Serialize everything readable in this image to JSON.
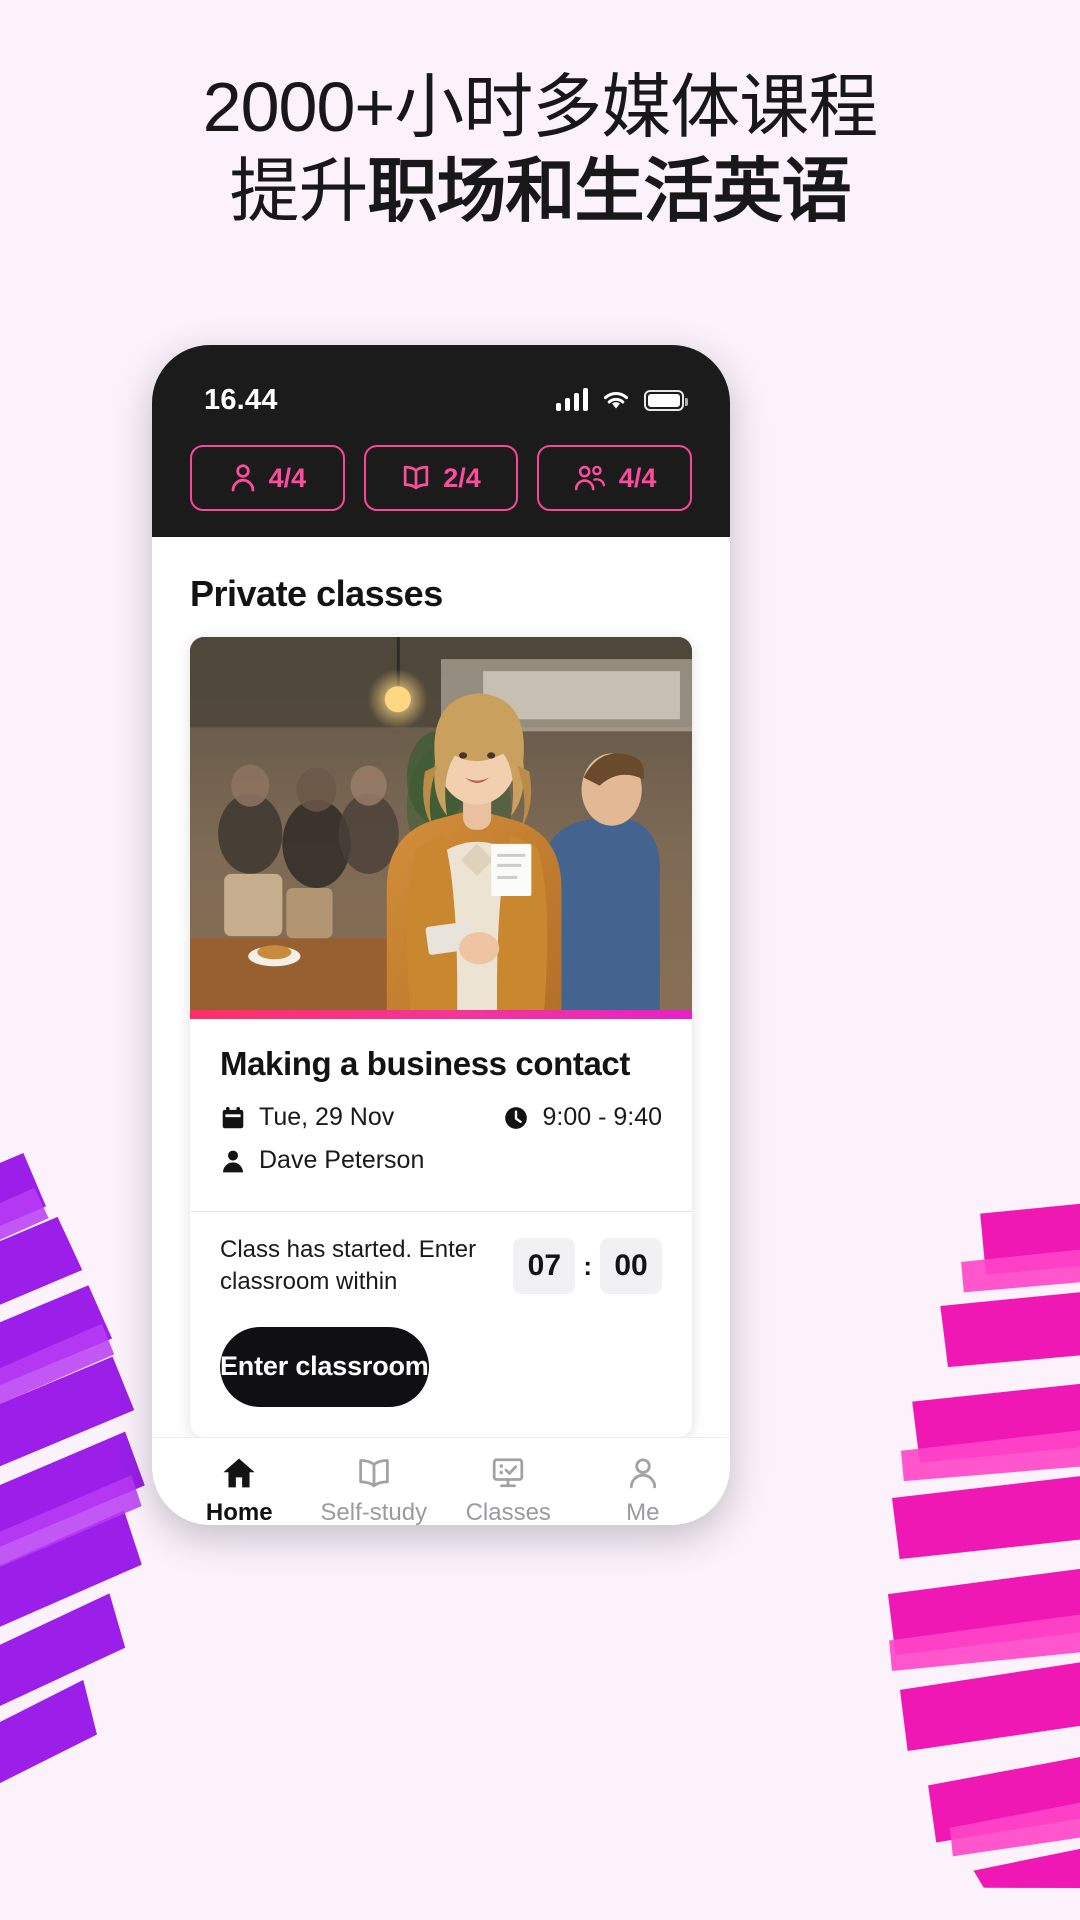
{
  "promo": {
    "line1": "2000+小时多媒体课程",
    "line2_regular": "提升",
    "line2_bold": "职场和生活英语",
    "background_color": "#fbf2fc",
    "accent_pink": "#f7469c",
    "accent_purple": "#a020f0"
  },
  "phone": {
    "status_bar": {
      "time": "16.44",
      "signal_icon": "signal-bars-icon",
      "wifi_icon": "wifi-icon",
      "battery_icon": "battery-icon"
    },
    "progress_badges": [
      {
        "icon": "person-icon",
        "value": "4/4"
      },
      {
        "icon": "book-icon",
        "value": "2/4"
      },
      {
        "icon": "group-icon",
        "value": "4/4"
      }
    ],
    "screen_title": "Private classes",
    "class_card": {
      "title": "Making a business contact",
      "date_icon": "calendar-icon",
      "date": "Tue, 29 Nov",
      "time_icon": "clock-icon",
      "time": "9:00 - 9:40",
      "teacher_icon": "person-icon",
      "teacher": "Dave Peterson",
      "countdown_message": "Class has started. Enter classroom within",
      "countdown_minutes": "07",
      "countdown_separator": ":",
      "countdown_seconds": "00",
      "cta_label": "Enter classroom"
    },
    "tabbar": [
      {
        "icon": "home-icon",
        "label": "Home",
        "active": true
      },
      {
        "icon": "book-icon",
        "label": "Self-study",
        "active": false
      },
      {
        "icon": "screen-check-icon",
        "label": "Classes",
        "active": false
      },
      {
        "icon": "person-icon",
        "label": "Me",
        "active": false
      }
    ]
  }
}
